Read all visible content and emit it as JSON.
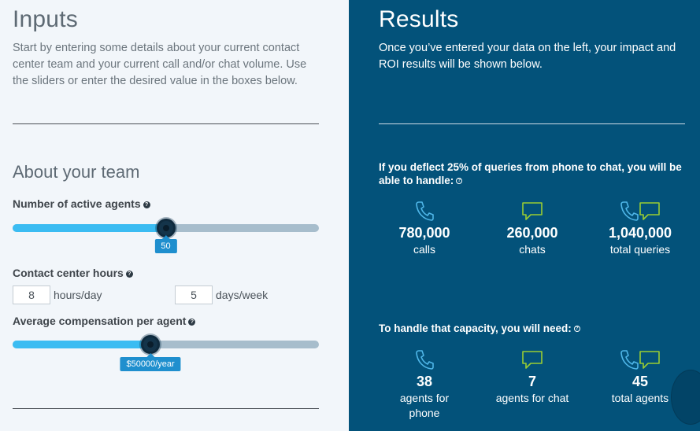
{
  "inputs": {
    "title": "Inputs",
    "intro": "Start by entering some details about your current contact center team and your current call and/or chat volume. Use the sliders or enter the desired value in the boxes below.",
    "section_title": "About your team",
    "agents": {
      "label": "Number of active agents",
      "value": "50",
      "fraction": 0.5
    },
    "hours": {
      "label": "Contact center hours",
      "hours_value": "8",
      "hours_unit": "hours/day",
      "days_value": "5",
      "days_unit": "days/week"
    },
    "compensation": {
      "label": "Average compensation per agent",
      "value": "$50000/year",
      "fraction": 0.45
    }
  },
  "results": {
    "title": "Results",
    "intro": "Once you’ve entered your data on the left, your impact and ROI results will be shown below.",
    "capacity": {
      "heading": "If you deflect 25% of queries from phone to chat, you will be able to handle:",
      "stats": [
        {
          "value": "780,000",
          "caption": "calls",
          "icon": "phone-icon"
        },
        {
          "value": "260,000",
          "caption": "chats",
          "icon": "chat-icon"
        },
        {
          "value": "1,040,000",
          "caption": "total queries",
          "icon": "phone-chat-icon"
        }
      ]
    },
    "needs": {
      "heading": "To handle that capacity, you will need:",
      "stats": [
        {
          "value": "38",
          "caption": "agents for phone",
          "icon": "phone-icon"
        },
        {
          "value": "7",
          "caption": "agents for chat",
          "icon": "chat-icon"
        },
        {
          "value": "45",
          "caption": "total agents",
          "icon": "phone-chat-icon"
        }
      ]
    }
  },
  "colors": {
    "accent": "#3bbcf2",
    "panel": "#03527a",
    "chat_icon": "#9acd32",
    "phone_icon": "#4fb6e8"
  }
}
